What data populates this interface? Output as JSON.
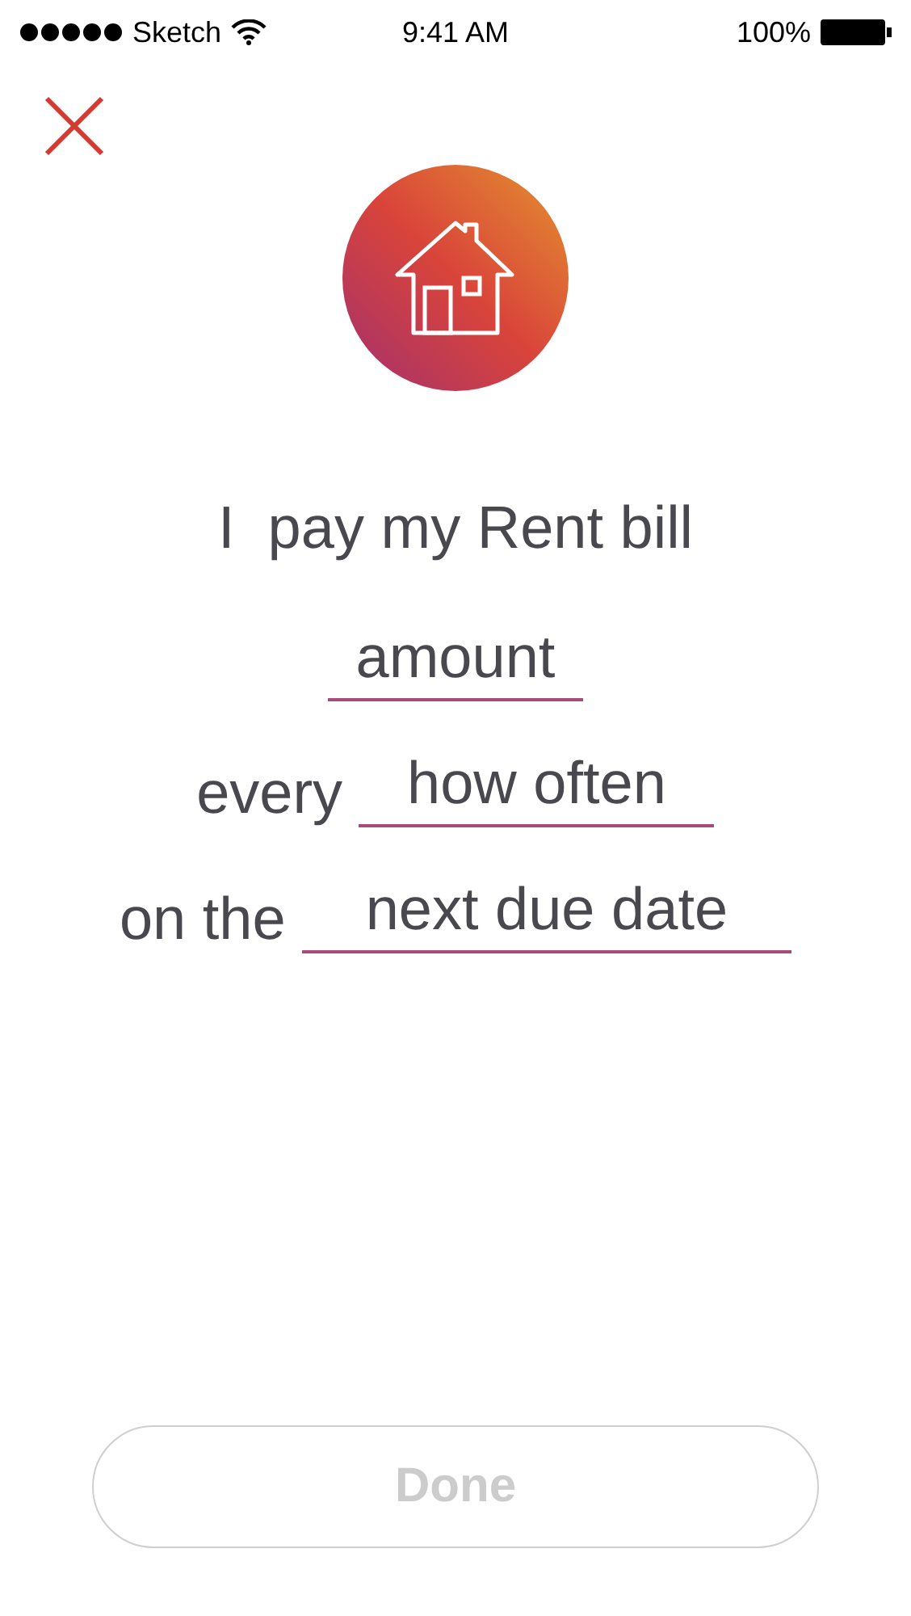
{
  "status_bar": {
    "carrier": "Sketch",
    "time": "9:41 AM",
    "battery": "100%"
  },
  "prompt": "I  pay my Rent bill",
  "lines": [
    {
      "placeholder": "amount"
    },
    {
      "prefix": "every",
      "placeholder": "how often"
    },
    {
      "prefix": "on the",
      "placeholder": "next due date"
    }
  ],
  "done_button": {
    "label": "Done",
    "disabled": true
  }
}
